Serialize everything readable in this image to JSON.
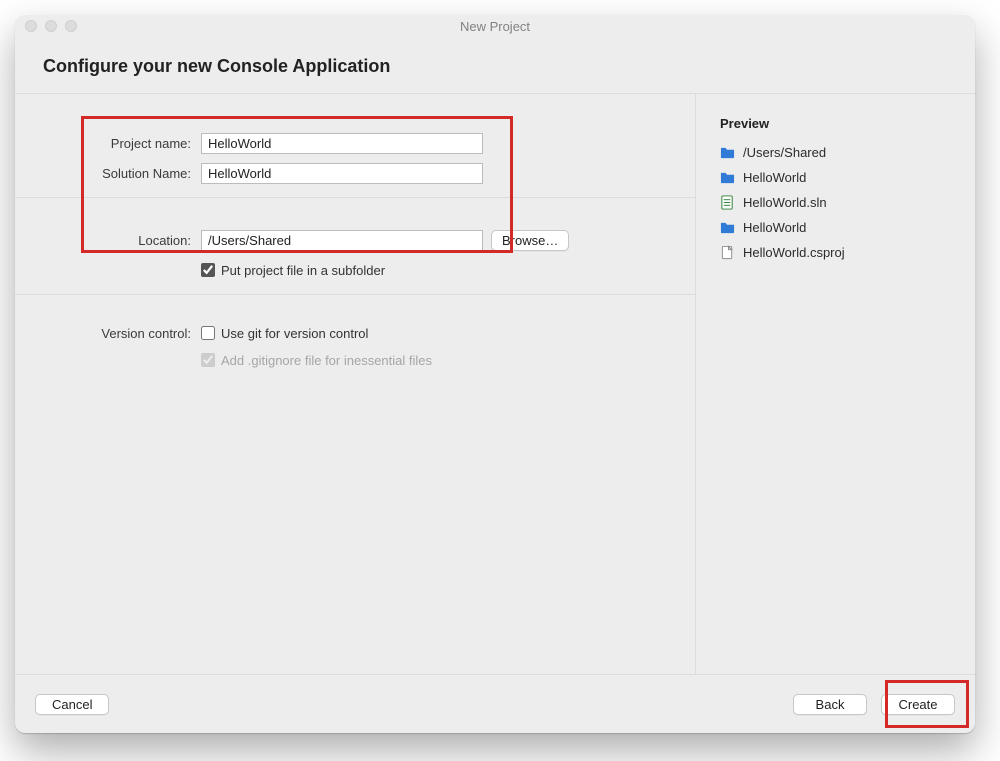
{
  "window": {
    "title": "New Project",
    "heading": "Configure your new Console Application"
  },
  "form": {
    "project_name_label": "Project name:",
    "project_name_value": "HelloWorld",
    "solution_name_label": "Solution Name:",
    "solution_name_value": "HelloWorld",
    "location_label": "Location:",
    "location_value": "/Users/Shared",
    "browse_label": "Browse…",
    "subfolder_label": "Put project file in a subfolder",
    "subfolder_checked": true,
    "vc_label": "Version control:",
    "vc_use_git_label": "Use git for version control",
    "vc_use_git_checked": false,
    "vc_gitignore_label": "Add .gitignore file for inessential files",
    "vc_gitignore_checked": true,
    "vc_gitignore_disabled": true
  },
  "preview": {
    "title": "Preview",
    "items": [
      {
        "icon": "folder",
        "label": "/Users/Shared"
      },
      {
        "icon": "folder",
        "label": "HelloWorld"
      },
      {
        "icon": "sln",
        "label": "HelloWorld.sln"
      },
      {
        "icon": "folder",
        "label": "HelloWorld"
      },
      {
        "icon": "csproj",
        "label": "HelloWorld.csproj"
      }
    ]
  },
  "footer": {
    "cancel_label": "Cancel",
    "back_label": "Back",
    "create_label": "Create"
  }
}
